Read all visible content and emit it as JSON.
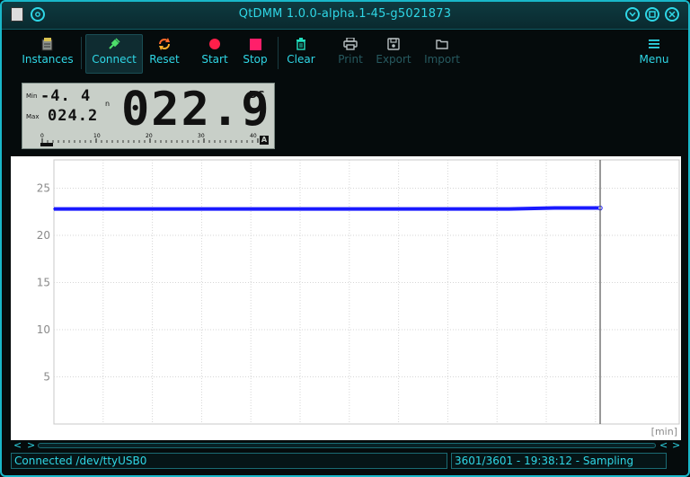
{
  "window": {
    "title": "QtDMM 1.0.0-alpha.1-45-g5021873"
  },
  "toolbar": {
    "instances": "Instances",
    "connect": "Connect",
    "reset": "Reset",
    "start": "Start",
    "stop": "Stop",
    "clear": "Clear",
    "print": "Print",
    "export": "Export",
    "import": "Import",
    "menu": "Menu"
  },
  "meter": {
    "min_label": "Min",
    "min_value": "-4.  4",
    "min_unit": "n",
    "max_label": "Max",
    "max_value": "024.2",
    "reading": "022.9",
    "mode": "DC",
    "scale_ticks": [
      "0",
      "10",
      "20",
      "30",
      "40"
    ],
    "auto_badge": "A"
  },
  "chart_data": {
    "type": "line",
    "title": "",
    "xlabel": "[min]",
    "ylabel": "",
    "yticks": [
      5,
      10,
      15,
      20,
      25
    ],
    "ylim": [
      0,
      28
    ],
    "xlim": [
      0,
      60
    ],
    "cursor_x": 60,
    "series": [
      {
        "color": "#1a1aff",
        "x": [
          0,
          5,
          10,
          15,
          20,
          25,
          30,
          35,
          40,
          45,
          50,
          55,
          60
        ],
        "values": [
          22.8,
          22.8,
          22.8,
          22.8,
          22.8,
          22.8,
          22.8,
          22.8,
          22.8,
          22.8,
          22.8,
          22.9,
          22.9
        ]
      }
    ],
    "grid": true
  },
  "statusbar": {
    "connection": "Connected /dev/ttyUSB0",
    "sampling": "3601/3601 - 19:38:12 - Sampling"
  },
  "colors": {
    "accent": "#2fd7e6",
    "disabled": "#275a60",
    "start_red": "#ff1f4a",
    "connect_green": "#4ddf6a",
    "reset_orange": "#ff6a2a",
    "clear_teal": "#22e0c0"
  }
}
